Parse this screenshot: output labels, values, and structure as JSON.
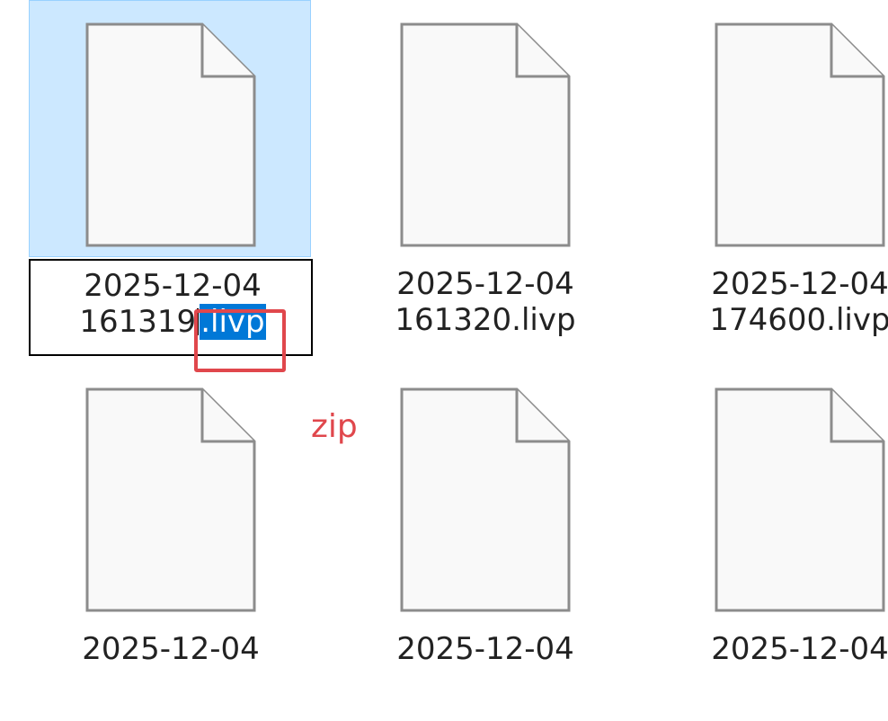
{
  "files": [
    {
      "date_line": "2025-12-04",
      "name_base": "161319",
      "name_ext": ".livp",
      "selected": true,
      "renaming": true
    },
    {
      "date_line": "2025-12-04",
      "name_line": "161320.livp"
    },
    {
      "date_line": "2025-12-04",
      "name_line": "174600.livp"
    },
    {
      "date_line": "2025-12-04"
    },
    {
      "date_line": "2025-12-04"
    },
    {
      "date_line": "2025-12-04"
    }
  ],
  "annotation": {
    "text": "zip",
    "color": "#e0474c"
  },
  "icons": {
    "file": "blank-document-icon"
  },
  "colors": {
    "selection_background": "#cce8ff",
    "text_selection": "#0078d7"
  }
}
